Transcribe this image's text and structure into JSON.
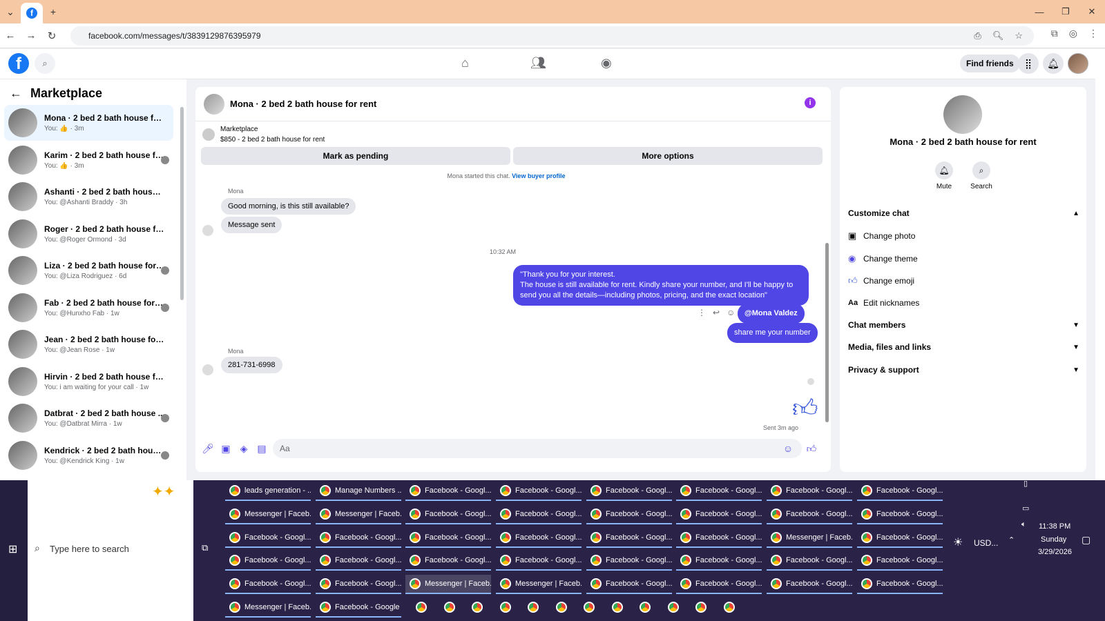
{
  "browser": {
    "url": "facebook.com/messages/t/3839129876395979"
  },
  "fb": {
    "find_friends": "Find friends"
  },
  "left": {
    "title": "Marketplace",
    "convs": [
      {
        "name": "Mona · 2 bed 2 bath house for r...",
        "prev": "You: 👍 · 3m"
      },
      {
        "name": "Karim · 2 bed 2 bath house fo...",
        "prev": "You: 👍 · 3m"
      },
      {
        "name": "Ashanti · 2 bed 2 bath house for...",
        "prev": "You: @Ashanti Braddy · 3h"
      },
      {
        "name": "Roger · 2 bed 2 bath house for r...",
        "prev": "You: @Roger Ormond · 3d"
      },
      {
        "name": "Liza · 2 bed 2 bath house for r...",
        "prev": "You: @Liza Rodriguez · 6d"
      },
      {
        "name": "Fab · 2 bed 2 bath house for r...",
        "prev": "You: @Hunxho Fab · 1w"
      },
      {
        "name": "Jean · 2 bed 2 bath house for rent",
        "prev": "You: @Jean Rose · 1w"
      },
      {
        "name": "Hirvin · 2 bed 2 bath house for r...",
        "prev": "You: i am waiting for your call · 1w"
      },
      {
        "name": "Datbrat · 2 bed 2 bath house ...",
        "prev": "You: @Datbrat Mirra · 1w"
      },
      {
        "name": "Kendrick · 2 bed 2 bath house...",
        "prev": "You: @Kendrick King · 1w"
      }
    ]
  },
  "chat": {
    "title": "Mona · 2 bed 2 bath house for rent",
    "mp_label": "Marketplace",
    "mp_price": "$850 - 2 bed 2 bath house for rent",
    "mark_pending": "Mark as pending",
    "more_options": "More options",
    "started": "Mona started this chat.",
    "view_profile": "View buyer profile",
    "sender": "Mona",
    "msg1": "Good morning, is this still available?",
    "msg2": "Message sent",
    "time": "10:32 AM",
    "out1": "\"Thank you for your interest.",
    "out2": "The house is still available for rent. Kindly share your number, and I'll be happy to",
    "out3": "send you all the details—including photos, pricing, and the exact location\"",
    "mention": "@Mona Valdez",
    "out4": "share me your number",
    "reply": "281-731-6998",
    "sent": "Sent 3m ago",
    "placeholder": "Aa"
  },
  "right": {
    "name": "Mona · 2 bed 2 bath house for rent",
    "mute": "Mute",
    "search": "Search",
    "customize": "Customize chat",
    "change_photo": "Change photo",
    "change_theme": "Change theme",
    "change_emoji": "Change emoji",
    "edit_nick": "Edit nicknames",
    "members": "Chat members",
    "media": "Media, files and links",
    "privacy": "Privacy & support"
  },
  "taskbar": {
    "search": "Type here to search",
    "time": "11:38 PM",
    "day": "Sunday",
    "date": "3/29/2026",
    "currency": "USD...",
    "items": [
      [
        "leads generation - ...",
        "Manage Numbers ...",
        "Facebook - Googl...",
        "Facebook - Googl...",
        "Facebook - Googl...",
        "Facebook - Googl...",
        "Facebook - Googl...",
        "Facebook - Googl..."
      ],
      [
        "Messenger | Faceb...",
        "Messenger | Faceb...",
        "Facebook - Googl...",
        "Facebook - Googl...",
        "Facebook - Googl...",
        "Facebook - Googl...",
        "Facebook - Googl...",
        "Facebook - Googl..."
      ],
      [
        "Facebook - Googl...",
        "Facebook - Googl...",
        "Facebook - Googl...",
        "Facebook - Googl...",
        "Facebook - Googl...",
        "Facebook - Googl...",
        "Messenger | Faceb...",
        "Facebook - Googl..."
      ],
      [
        "Facebook - Googl...",
        "Facebook - Googl...",
        "Facebook - Googl...",
        "Facebook - Googl...",
        "Facebook - Googl...",
        "Facebook - Googl...",
        "Facebook - Googl...",
        "Facebook - Googl..."
      ],
      [
        "Facebook - Googl...",
        "Facebook - Googl...",
        "Messenger | Faceb...",
        "Messenger | Faceb...",
        "Facebook - Googl...",
        "Facebook - Googl...",
        "Facebook - Googl...",
        "Facebook - Googl..."
      ],
      [
        "Messenger | Faceb...",
        "Facebook - Google ..."
      ]
    ]
  }
}
